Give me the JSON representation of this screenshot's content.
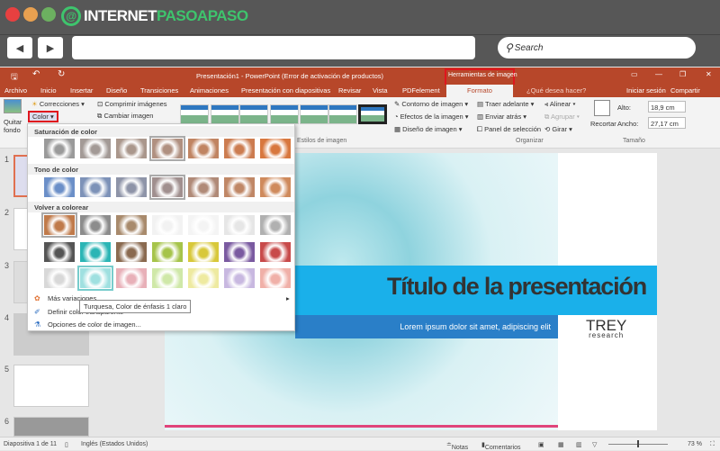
{
  "browser": {
    "logo_text_a": "INTERNET",
    "logo_text_b": "PASOAPASO",
    "search_placeholder": "Search",
    "back": "◀",
    "forward": "▶"
  },
  "window": {
    "title": "Presentación1 - PowerPoint (Error de activación de productos)",
    "context_tab_group": "Herramientas de imagen",
    "controls": [
      "▭",
      "—",
      "❐",
      "✕"
    ]
  },
  "tabs": [
    "Archivo",
    "Inicio",
    "Insertar",
    "Diseño",
    "Transiciones",
    "Animaciones",
    "Presentación con diapositivas",
    "Revisar",
    "Vista",
    "PDFelement"
  ],
  "active_tab": "Formato",
  "tell_me": "¿Qué desea hacer?",
  "sign_in": "Iniciar sesión",
  "share": "Compartir",
  "ribbon": {
    "quitar_fondo": "Quitar fondo",
    "correcciones": "Correcciones",
    "color": "Color",
    "comprimir": "Comprimir imágenes",
    "cambiar": "Cambiar imagen",
    "estilos_label": "Estilos de imagen",
    "contorno": "Contorno de imagen",
    "efectos": "Efectos de la imagen",
    "diseno": "Diseño de imagen",
    "traer": "Traer adelante",
    "enviar": "Enviar atrás",
    "panel": "Panel de selección",
    "alinear": "Alinear",
    "agrupar": "Agrupar",
    "girar": "Girar",
    "organizar_label": "Organizar",
    "recortar": "Recortar",
    "alto_label": "Alto:",
    "alto_value": "18,9 cm",
    "ancho_label": "Ancho:",
    "ancho_value": "27,17 cm",
    "tamano_label": "Tamaño"
  },
  "color_menu": {
    "saturation_header": "Saturación de color",
    "tone_header": "Tono de color",
    "recolor_header": "Volver a colorear",
    "saturation": [
      "#9a9a9a",
      "#a39a96",
      "#aa978c",
      "#b09080",
      "#c08462",
      "#cc7c50",
      "#d8773e"
    ],
    "tone": [
      "#6b8fc8",
      "#7d92b8",
      "#8e94a8",
      "#a08f8e",
      "#b08a78",
      "#c08766",
      "#cf8a5c"
    ],
    "recolor_rows": [
      [
        "#c07a4a",
        "#8c8c8c",
        "#a88a6c",
        "#f2f2f2",
        "#f4f4f4",
        "#e6e6e6",
        "#b0b0b0"
      ],
      [
        "#555555",
        "#2bb5b5",
        "#8a6a50",
        "#a6c44a",
        "#d8c83a",
        "#7a5aa0",
        "#c84a4a"
      ],
      [
        "#d8d8d8",
        "#9fe0e0",
        "#e8b0b8",
        "#cfe8a8",
        "#eeeaa0",
        "#c8b8e0",
        "#f0b0a8"
      ]
    ],
    "selected": "Turquesa, Color de énfasis 1 claro",
    "items": [
      "Más variaciones",
      "Definir color transparente",
      "Opciones de color de imagen..."
    ]
  },
  "tooltip": "Turquesa, Color de énfasis 1 claro",
  "slides": [
    "1",
    "2",
    "3",
    "4",
    "5",
    "6"
  ],
  "slide": {
    "title": "Título de la presentación",
    "subtitle": "Lorem ipsum dolor sit amet, adipiscing elit",
    "logo_main": "TREY",
    "logo_sub": "research"
  },
  "status": {
    "slide_of": "Diapositiva 1 de 11",
    "language": "Inglés (Estados Unidos)",
    "notes": "Notas",
    "comments": "Comentarios",
    "zoom": "73 %"
  },
  "colors": {
    "accent": "#b7472a",
    "highlight": "#e0161e",
    "slide_blue": "#1ab0ea"
  }
}
